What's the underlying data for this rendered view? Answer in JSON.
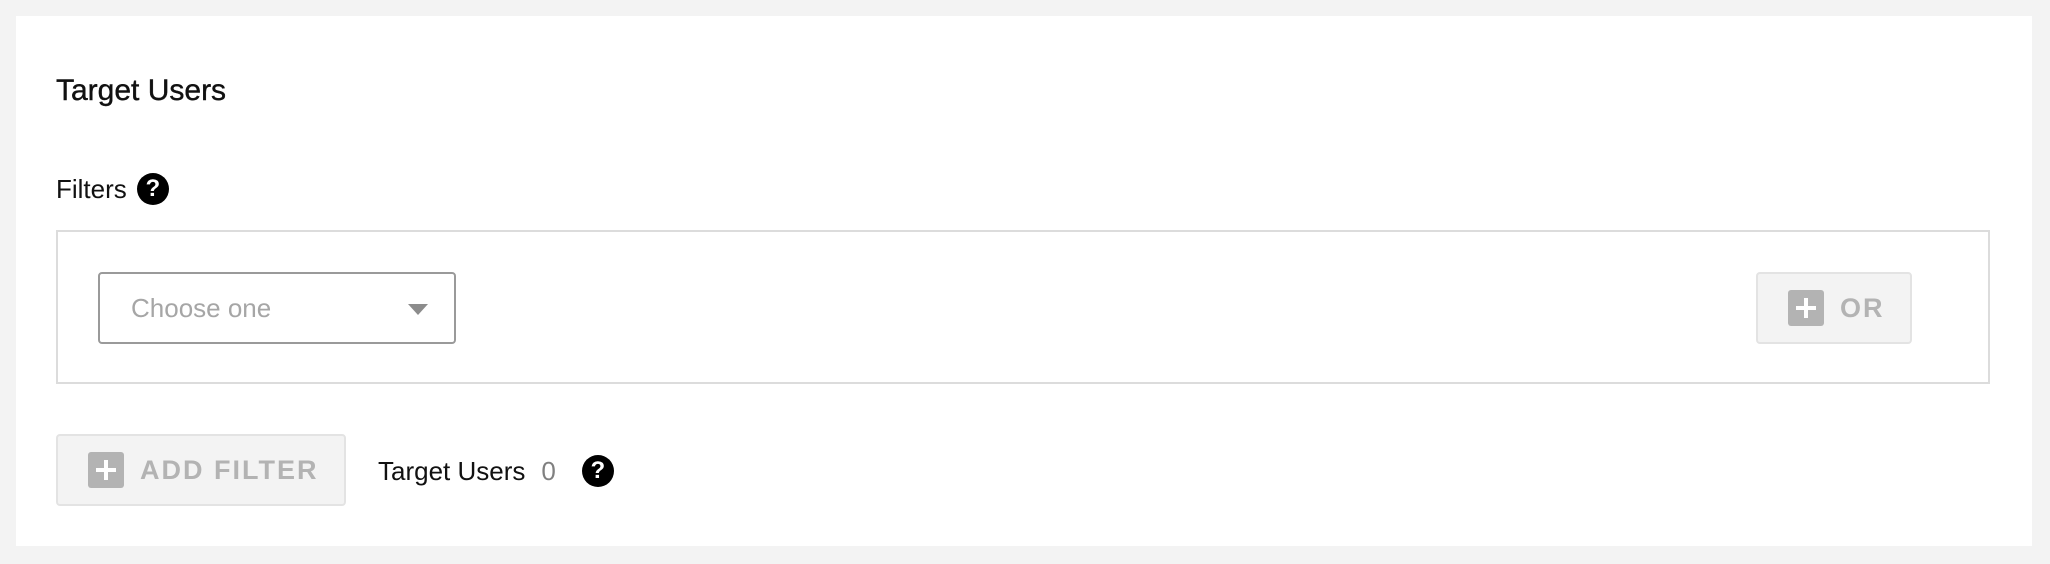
{
  "section": {
    "title": "Target Users"
  },
  "filters": {
    "label": "Filters",
    "help_icon": "question-icon",
    "select": {
      "placeholder": "Choose one",
      "icon": "chevron-down-icon"
    },
    "or_button": {
      "label": "OR",
      "icon": "plus-icon",
      "disabled": true
    }
  },
  "footer": {
    "add_filter_button": {
      "label": "ADD FILTER",
      "icon": "plus-icon",
      "disabled": true
    },
    "target_users_label": "Target Users",
    "target_users_count": "0",
    "help_icon": "question-icon"
  },
  "colors": {
    "page_background": "#f3f3f3",
    "card_background": "#ffffff",
    "text": "#111111",
    "disabled_text": "#b3b3b3",
    "help_icon": "#000000"
  }
}
